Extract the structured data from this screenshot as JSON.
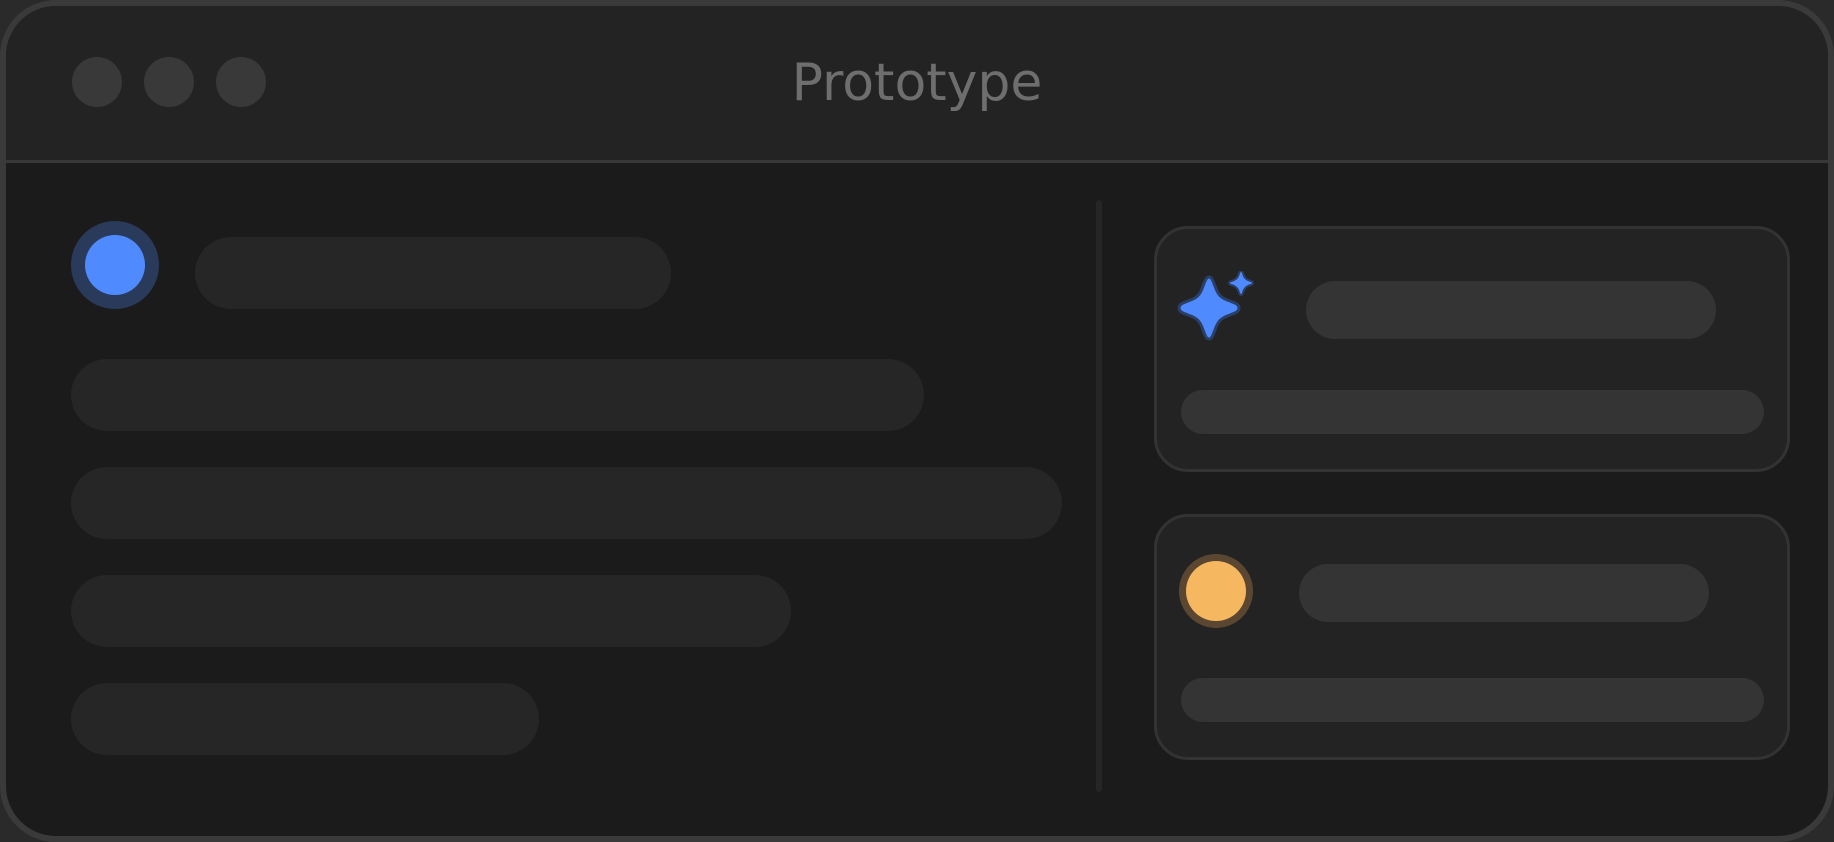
{
  "window": {
    "title": "Prototype"
  },
  "colors": {
    "accent_blue": "#4f8bff",
    "accent_orange": "#f5b75f",
    "background": "#1b1b1b",
    "titlebar": "#232323",
    "placeholder": "#262626",
    "card_placeholder": "#343434"
  },
  "icons": {
    "window_controls": [
      "close-button-icon",
      "minimize-button-icon",
      "zoom-button-icon"
    ],
    "card1_icon": "sparkle-icon",
    "card2_icon": "status-dot-icon"
  }
}
